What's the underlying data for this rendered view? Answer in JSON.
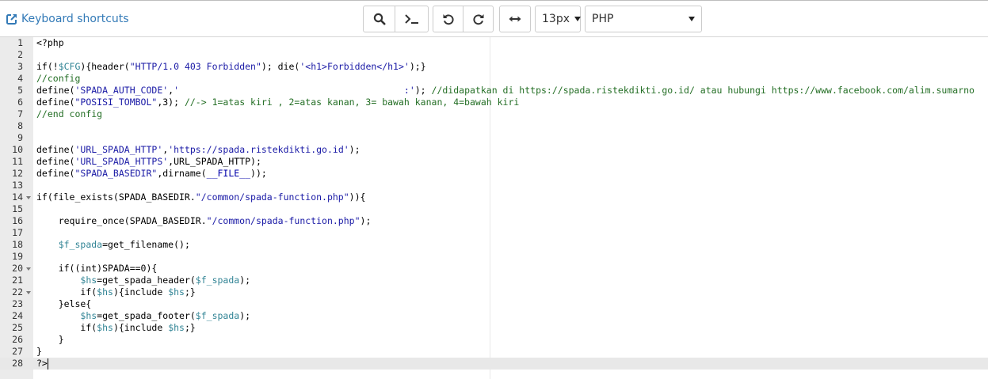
{
  "toolbar": {
    "shortcuts_label": "Keyboard shortcuts",
    "buttons": {
      "search": "search-icon",
      "console": "terminal-icon",
      "undo": "undo-icon",
      "redo": "redo-icon",
      "wrap": "horizontal-arrows-icon"
    },
    "font_size": "13px",
    "language": "PHP"
  },
  "colors": {
    "link": "#337ab7",
    "gutter": "#ebebeb",
    "active_line": "#e8e8e8",
    "comment": "#236e24",
    "string": "#1a1aa6",
    "variable": "#318495"
  },
  "editor": {
    "active_line": 28,
    "fold_lines": [
      14,
      20,
      22
    ],
    "lines": [
      [
        [
          "t",
          "<?php"
        ]
      ],
      [],
      [
        [
          "t",
          "if(!"
        ],
        [
          "v",
          "$CFG"
        ],
        [
          "t",
          "){header("
        ],
        [
          "s",
          "\"HTTP/1.0 403 Forbidden\""
        ],
        [
          "t",
          "); die("
        ],
        [
          "s",
          "'<h1>Forbidden</h1>'"
        ],
        [
          "t",
          ");}"
        ]
      ],
      [
        [
          "c",
          "//config"
        ]
      ],
      [
        [
          "t",
          "define("
        ],
        [
          "s",
          "'SPADA_AUTH_CODE'"
        ],
        [
          "t",
          ","
        ],
        [
          "s",
          "'                                         :'"
        ],
        [
          "t",
          "); "
        ],
        [
          "c",
          "//didapatkan di https://spada.ristekdikti.go.id/ atau hubungi https://www.facebook.com/alim.sumarno"
        ]
      ],
      [
        [
          "t",
          "define("
        ],
        [
          "s",
          "\"POSISI_TOMBOL\""
        ],
        [
          "t",
          ",3); "
        ],
        [
          "c",
          "//-> 1=atas kiri , 2=atas kanan, 3= bawah kanan, 4=bawah kiri"
        ]
      ],
      [
        [
          "c",
          "//end config"
        ]
      ],
      [],
      [],
      [
        [
          "t",
          "define("
        ],
        [
          "s",
          "'URL_SPADA_HTTP'"
        ],
        [
          "t",
          ","
        ],
        [
          "s",
          "'https://spada.ristekdikti.go.id'"
        ],
        [
          "t",
          ");"
        ]
      ],
      [
        [
          "t",
          "define("
        ],
        [
          "s",
          "'URL_SPADA_HTTPS'"
        ],
        [
          "t",
          ",URL_SPADA_HTTP);"
        ]
      ],
      [
        [
          "t",
          "define("
        ],
        [
          "s",
          "\"SPADA_BASEDIR\""
        ],
        [
          "t",
          ",dirname("
        ],
        [
          "k",
          "__FILE__"
        ],
        [
          "t",
          "));"
        ]
      ],
      [],
      [
        [
          "t",
          "if(file_exists(SPADA_BASEDIR."
        ],
        [
          "s",
          "\"/common/spada-function.php\""
        ],
        [
          "t",
          ")){"
        ]
      ],
      [],
      [
        [
          "t",
          "    require_once(SPADA_BASEDIR."
        ],
        [
          "s",
          "\"/common/spada-function.php\""
        ],
        [
          "t",
          ");"
        ]
      ],
      [],
      [
        [
          "t",
          "    "
        ],
        [
          "v",
          "$f_spada"
        ],
        [
          "t",
          "=get_filename();"
        ]
      ],
      [],
      [
        [
          "t",
          "    if((int)SPADA==0){"
        ]
      ],
      [
        [
          "t",
          "        "
        ],
        [
          "v",
          "$hs"
        ],
        [
          "t",
          "=get_spada_header("
        ],
        [
          "v",
          "$f_spada"
        ],
        [
          "t",
          ");"
        ]
      ],
      [
        [
          "t",
          "        if("
        ],
        [
          "v",
          "$hs"
        ],
        [
          "t",
          "){include "
        ],
        [
          "v",
          "$hs"
        ],
        [
          "t",
          ";}"
        ]
      ],
      [
        [
          "t",
          "    }else{"
        ]
      ],
      [
        [
          "t",
          "        "
        ],
        [
          "v",
          "$hs"
        ],
        [
          "t",
          "=get_spada_footer("
        ],
        [
          "v",
          "$f_spada"
        ],
        [
          "t",
          ");"
        ]
      ],
      [
        [
          "t",
          "        if("
        ],
        [
          "v",
          "$hs"
        ],
        [
          "t",
          "){include "
        ],
        [
          "v",
          "$hs"
        ],
        [
          "t",
          ";}"
        ]
      ],
      [
        [
          "t",
          "    }"
        ]
      ],
      [
        [
          "t",
          "}"
        ]
      ],
      [
        [
          "t",
          "?>"
        ]
      ]
    ]
  }
}
